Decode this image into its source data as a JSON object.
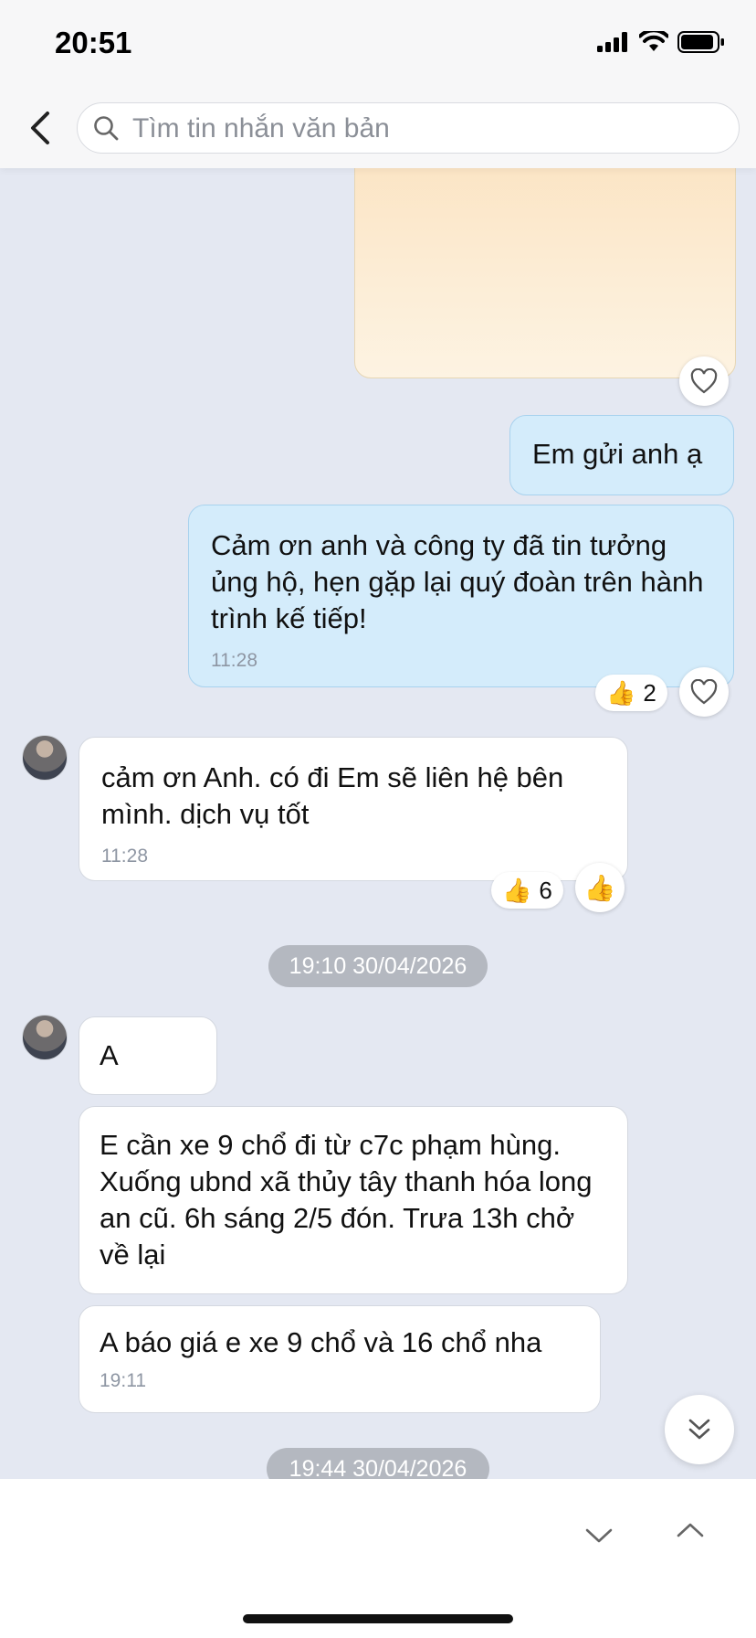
{
  "status_bar": {
    "time": "20:51"
  },
  "search": {
    "placeholder": "Tìm tin nhắn văn bản"
  },
  "messages": [
    {
      "text": "Em gửi anh ạ"
    },
    {
      "text": "Cảm ơn anh và công ty đã tin tưởng ủng hộ, hẹn gặp lại quý đoàn trên hành trình kế tiếp!",
      "time": "11:28",
      "reaction": "👍",
      "reaction_count": "2"
    },
    {
      "text": "cảm ơn Anh. có đi Em sẽ liên hệ bên mình. dịch vụ tốt",
      "time": "11:28",
      "reaction": "👍",
      "reaction_count": "6"
    },
    {
      "text": "A"
    },
    {
      "text": "E cần xe 9 chổ đi từ c7c phạm hùng. Xuống ubnd xã thủy tây thanh hóa long an cũ. 6h sáng 2/5 đón. Trưa 13h chở về lại"
    },
    {
      "text": "A báo giá e xe 9 chổ và 16 chổ nha",
      "time": "19:11"
    }
  ],
  "date_separators": [
    "19:10 30/04/2026",
    "19:44 30/04/2026"
  ],
  "icons": {
    "back": "chevron-left-icon",
    "search": "search-icon",
    "heart": "heart-icon",
    "like": "thumbs-up-icon",
    "scroll_down": "double-chevron-down-icon",
    "prev": "chevron-down-icon",
    "next": "chevron-up-icon"
  },
  "colors": {
    "outgoing_bubble": "#d4ecfb",
    "incoming_bubble": "#ffffff",
    "background": "#e4e8f2"
  }
}
